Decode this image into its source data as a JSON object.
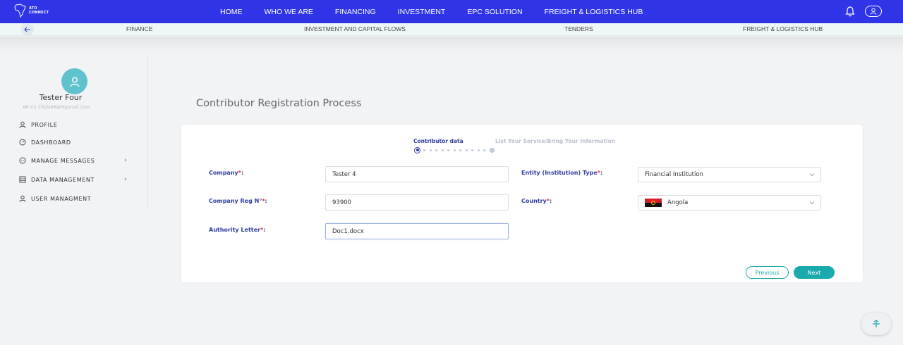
{
  "brand": {
    "logo_line1": "ATO",
    "logo_line2": "CONNECT"
  },
  "nav": {
    "items": [
      {
        "label": "HOME"
      },
      {
        "label": "WHO WE ARE"
      },
      {
        "label": "FINANCING"
      },
      {
        "label": "INVESTMENT"
      },
      {
        "label": "EPC SOLUTION"
      },
      {
        "label": "FREIGHT & LOGISTICS HUB"
      }
    ]
  },
  "subnav": {
    "items": [
      {
        "label": "FINANCE"
      },
      {
        "label": "INVESTMENT AND CAPITAL FLOWS"
      },
      {
        "label": "TENDERS"
      },
      {
        "label": "FREIGHT & LOGISTICS HUB"
      }
    ]
  },
  "user": {
    "name": "Tester Four",
    "email": "Alt.V2-2fipls96@Yopmail.Com"
  },
  "sidebar": {
    "items": [
      {
        "label": "PROFILE"
      },
      {
        "label": "DASHBOARD"
      },
      {
        "label": "MANAGE MESSAGES"
      },
      {
        "label": "DATA MANAGEMENT"
      },
      {
        "label": "USER MANAGMENT"
      }
    ]
  },
  "page": {
    "title": "Contributor Registration Process"
  },
  "steps": {
    "active": "Contributor data",
    "next": "List Your Service/Bring Your Information"
  },
  "form": {
    "company": {
      "label": "Company",
      "value": "Tester 4"
    },
    "entity_type": {
      "label": "Entity (Institution) Type",
      "value": "Financial Institution"
    },
    "company_reg": {
      "label": "Company Reg N°",
      "value": "93900"
    },
    "country": {
      "label": "Country",
      "value": "Angola"
    },
    "authority_letter": {
      "label": "Authority Letter",
      "value": "Doc1.docx"
    },
    "required_mark": "*",
    "colon": ":"
  },
  "buttons": {
    "previous": "Previous",
    "next": "Next"
  },
  "colors": {
    "nav_bg": "#2f34e6",
    "accent_teal": "#1aa9ac",
    "label_blue": "#2e3d9e",
    "required_red": "#e0302e"
  }
}
